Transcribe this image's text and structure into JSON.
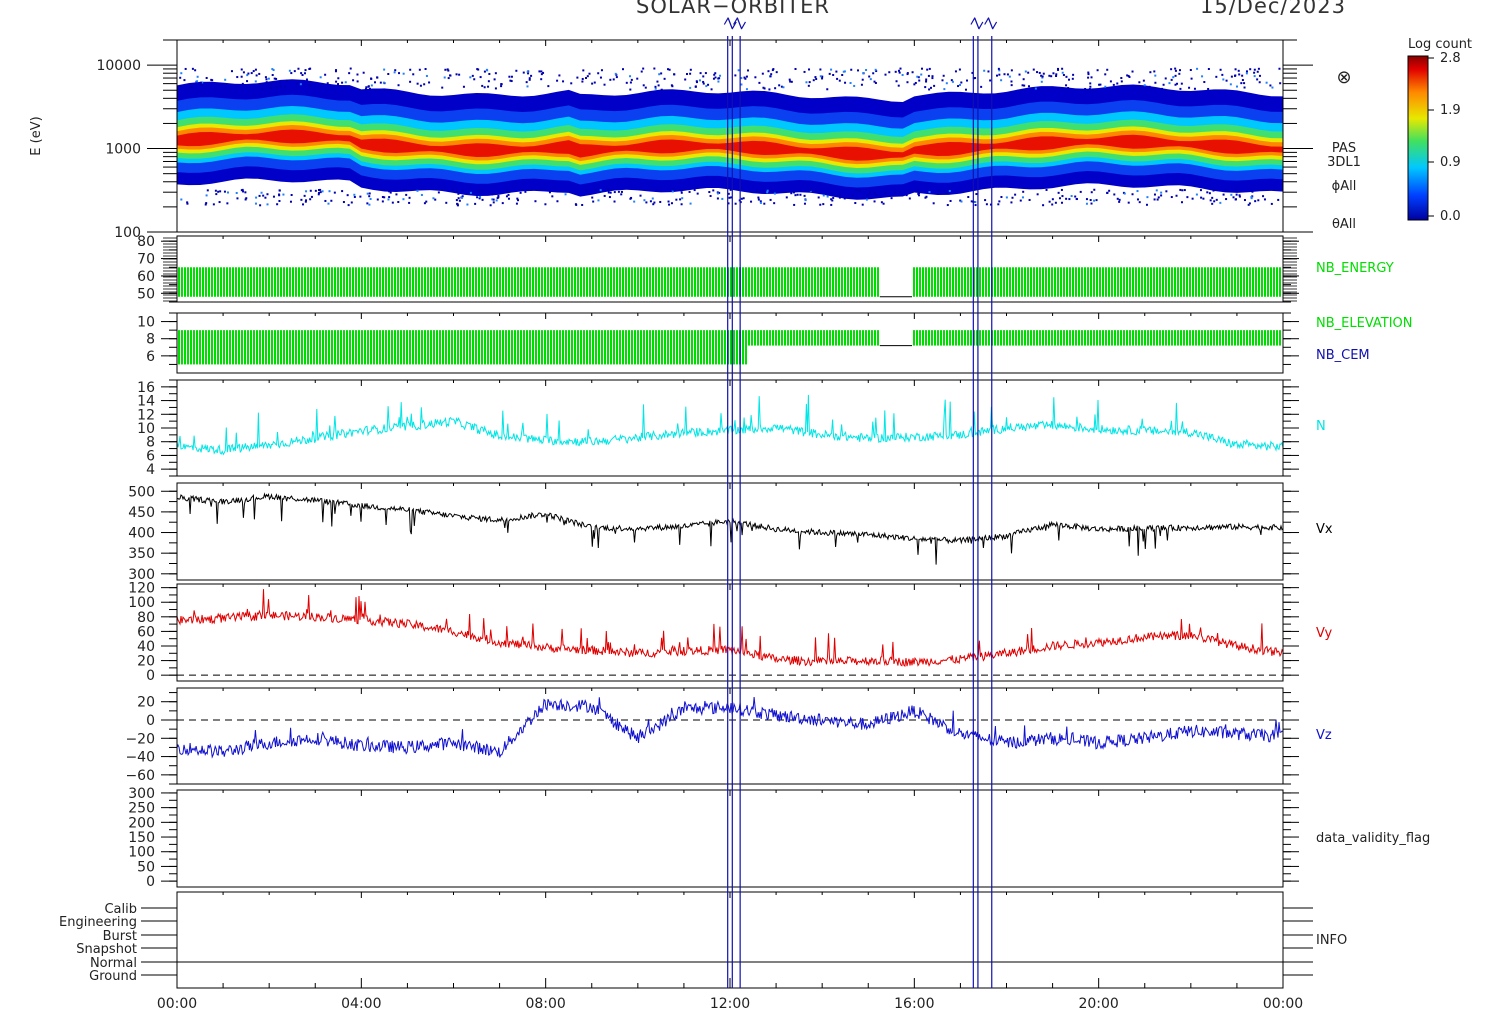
{
  "header": {
    "mission": "SOLAR−ORBITER",
    "date": "15/Dec/2023"
  },
  "colorbar": {
    "title": "Log count",
    "ticks": [
      "2.8",
      "1.9",
      "0.9",
      "0.0"
    ]
  },
  "x_axis": {
    "ticks": [
      "00:00",
      "04:00",
      "08:00",
      "12:00",
      "16:00",
      "20:00",
      "00:00"
    ],
    "range_hours": [
      0,
      24
    ]
  },
  "event_markers": {
    "labels": [
      "Z",
      "Z",
      "Z",
      "Z"
    ],
    "color": "#1010b0"
  },
  "chart_data": [
    {
      "type": "heatmap",
      "ylabel": "E (eV)",
      "yscale": "log",
      "ylim": [
        100,
        20000
      ],
      "yticks": [
        "10000",
        "1000",
        "100"
      ],
      "labels": [
        "PAS",
        "3DL1",
        "ϕAll",
        "θAll"
      ],
      "colormap": "rainbow",
      "clim": [
        0.0,
        2.8
      ]
    },
    {
      "type": "bar",
      "ylim": [
        45,
        83
      ],
      "yticks": [
        "80",
        "70",
        "60",
        "50"
      ],
      "label": "NB_ENERGY",
      "value_range": [
        48,
        65
      ],
      "color": "#00dd00"
    },
    {
      "type": "bar",
      "ylim": [
        4,
        11
      ],
      "yticks": [
        "10",
        "8",
        "6"
      ],
      "labels": [
        "NB_ELEVATION",
        "NB_CEM"
      ],
      "value_range": [
        5,
        9
      ],
      "colors": [
        "#00dd00",
        "#1010b0"
      ]
    },
    {
      "type": "line",
      "ylim": [
        3,
        17
      ],
      "yticks": [
        "16",
        "14",
        "12",
        "10",
        "8",
        "6",
        "4"
      ],
      "label": "N",
      "color": "#00e5e5",
      "x": [
        0,
        1,
        2,
        3,
        4,
        5,
        6,
        7,
        8,
        9,
        10,
        11,
        12,
        13,
        14,
        15,
        16,
        17,
        18,
        19,
        20,
        21,
        22,
        23,
        24
      ],
      "values": [
        7.3,
        6.8,
        7.5,
        8.5,
        9.6,
        10.2,
        11.0,
        8.8,
        8.2,
        8.0,
        8.6,
        9.3,
        9.6,
        10.1,
        9.0,
        8.5,
        8.7,
        9.0,
        10.0,
        10.4,
        9.8,
        9.6,
        9.4,
        7.5,
        7.3
      ]
    },
    {
      "type": "line",
      "ylim": [
        285,
        520
      ],
      "yticks": [
        "500",
        "450",
        "400",
        "350",
        "300"
      ],
      "label": "Vx",
      "color": "#000000",
      "x": [
        0,
        1,
        2,
        3,
        4,
        5,
        6,
        7,
        8,
        9,
        10,
        11,
        12,
        13,
        14,
        15,
        16,
        17,
        18,
        19,
        20,
        21,
        22,
        23,
        24
      ],
      "values": [
        485,
        475,
        488,
        478,
        465,
        455,
        440,
        430,
        445,
        412,
        410,
        415,
        428,
        408,
        400,
        395,
        385,
        380,
        392,
        420,
        408,
        410,
        412,
        414,
        412
      ]
    },
    {
      "type": "line",
      "ylim": [
        -8,
        125
      ],
      "yticks": [
        "120",
        "100",
        "80",
        "60",
        "40",
        "20",
        "0"
      ],
      "label": "Vy",
      "color": "#e00000",
      "zero_line": true,
      "x": [
        0,
        1,
        2,
        3,
        4,
        5,
        6,
        7,
        8,
        9,
        10,
        11,
        12,
        13,
        14,
        15,
        16,
        17,
        18,
        19,
        20,
        21,
        22,
        23,
        24
      ],
      "values": [
        75,
        78,
        82,
        80,
        76,
        70,
        60,
        45,
        38,
        34,
        30,
        33,
        35,
        22,
        18,
        20,
        18,
        22,
        30,
        40,
        45,
        52,
        55,
        40,
        30
      ]
    },
    {
      "type": "line",
      "ylim": [
        -70,
        35
      ],
      "yticks": [
        "20",
        "0",
        "−20",
        "−40",
        "−60"
      ],
      "label": "Vz",
      "color": "#1010d0",
      "zero_line": true,
      "x": [
        0,
        1,
        2,
        3,
        4,
        5,
        6,
        7,
        8,
        9,
        10,
        11,
        12,
        13,
        14,
        15,
        16,
        17,
        18,
        19,
        20,
        21,
        22,
        23,
        24
      ],
      "values": [
        -30,
        -35,
        -25,
        -20,
        -28,
        -30,
        -25,
        -35,
        18,
        15,
        -20,
        12,
        14,
        5,
        0,
        -5,
        10,
        -15,
        -25,
        -20,
        -25,
        -20,
        -12,
        -15,
        -18
      ]
    },
    {
      "type": "line",
      "ylim": [
        -20,
        310
      ],
      "yticks": [
        "300",
        "250",
        "200",
        "150",
        "100",
        "50",
        "0"
      ],
      "label": "data_validity_flag"
    },
    {
      "type": "table",
      "categories": [
        "Calib",
        "Engineering",
        "Burst",
        "Snapshot",
        "Normal",
        "Ground"
      ],
      "label": "INFO",
      "active_category": "Normal"
    }
  ]
}
